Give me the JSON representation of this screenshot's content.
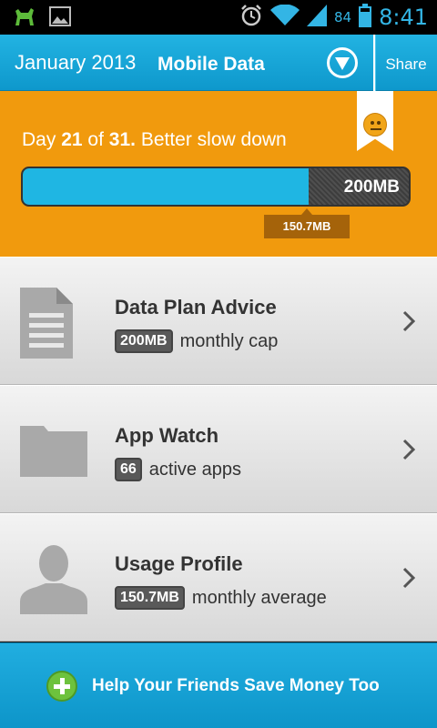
{
  "status_bar": {
    "battery_level": "84",
    "time": "8:41",
    "icons": [
      "android-icon",
      "gallery-icon",
      "alarm-icon",
      "wifi-icon",
      "signal-icon",
      "battery-icon"
    ]
  },
  "header": {
    "month": "January 2013",
    "title": "Mobile Data",
    "share_label": "Share"
  },
  "summary": {
    "day_label": "Day",
    "day_current": "21",
    "of_label": "of",
    "day_total": "31.",
    "message": "Better slow down",
    "cap_label": "200MB",
    "used_label": "150.7MB",
    "usage_fraction": 0.74,
    "mood_icon": "neutral-face-icon"
  },
  "rows": [
    {
      "title": "Data Plan Advice",
      "badge": "200MB",
      "subtitle": "monthly cap",
      "icon": "document-icon"
    },
    {
      "title": "App Watch",
      "badge": "66",
      "subtitle": "active apps",
      "icon": "folder-icon"
    },
    {
      "title": "Usage Profile",
      "badge": "150.7MB",
      "subtitle": "monthly average",
      "icon": "person-icon"
    }
  ],
  "footer": {
    "label": "Help Your Friends Save Money Too"
  },
  "colors": {
    "accent_blue": "#1fb6e3",
    "summary_orange": "#f19a0d",
    "plus_green": "#6dc23d"
  }
}
